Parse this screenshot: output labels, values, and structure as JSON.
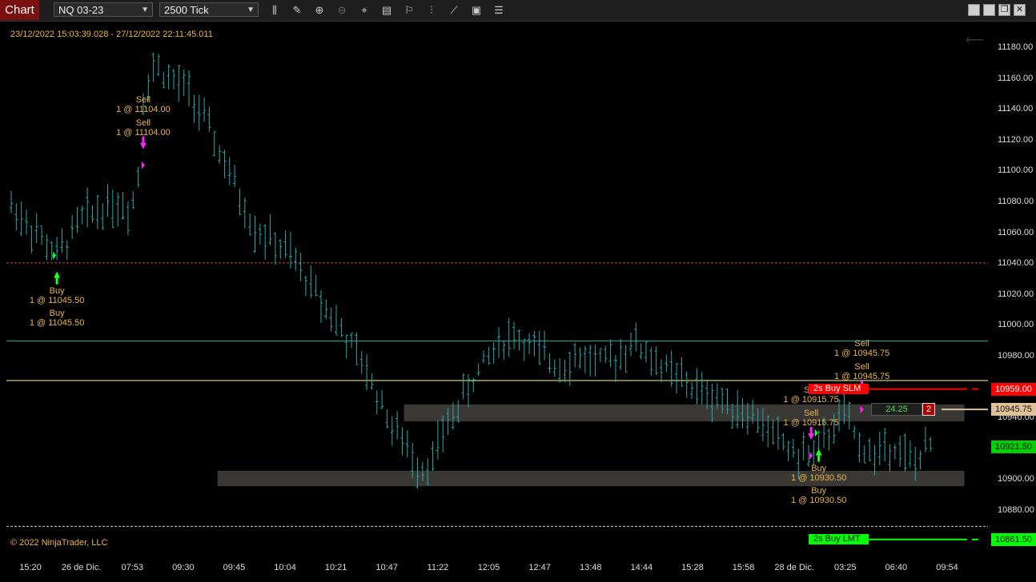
{
  "toolbar": {
    "tab_label": "Chart",
    "instrument": "NQ 03-23",
    "interval": "2500 Tick",
    "tools": [
      "bars-type-icon",
      "draw-tool-icon",
      "zoom-in-icon",
      "zoom-out-icon",
      "crosshair-icon",
      "properties-icon",
      "templates-icon",
      "indicators-icon",
      "strategies-icon",
      "chart-trader-icon",
      "data-box-icon"
    ],
    "window_buttons": [
      "minimize-icon",
      "restore-icon",
      "maximize-icon",
      "close-icon"
    ]
  },
  "chart": {
    "date_range": "23/12/2022 15:03:39.028 - 27/12/2022 22:11:45.011",
    "copyright": "© 2022 NinjaTrader, LLC",
    "colors": {
      "bars": "#2aa8a8",
      "buy_arrow": "#22ff22",
      "sell_arrow": "#ff22ff",
      "annotation": "#e8b34a",
      "zone": "#3a3834"
    }
  },
  "chart_data": {
    "type": "bar",
    "subtype": "ohlc",
    "instrument": "NQ 03-23",
    "interval": "2500 Tick",
    "ylim": [
      10850,
      11195
    ],
    "y_ticks": [
      11180.0,
      11160.0,
      11140.0,
      11120.0,
      11100.0,
      11080.0,
      11060.0,
      11040.0,
      11020.0,
      11000.0,
      10980.0,
      10940.0,
      10920.0,
      10900.0,
      10880.0
    ],
    "x_ticks": [
      "15:20",
      "26 de Dic.",
      "07:53",
      "09:30",
      "09:45",
      "10:04",
      "10:21",
      "10:47",
      "11:22",
      "12:05",
      "12:47",
      "13:48",
      "14:44",
      "15:28",
      "15:58",
      "28 de Dic.",
      "03:25",
      "06:40",
      "09:54"
    ],
    "bar_count": 168,
    "price_path": [
      [
        0,
        11078
      ],
      [
        10,
        11060
      ],
      [
        18,
        11045
      ],
      [
        28,
        11070
      ],
      [
        40,
        11080
      ],
      [
        47,
        11075
      ],
      [
        50,
        11098
      ],
      [
        52,
        11150
      ],
      [
        57,
        11170
      ],
      [
        62,
        11160
      ],
      [
        70,
        11152
      ],
      [
        80,
        11120
      ],
      [
        95,
        11065
      ],
      [
        110,
        11045
      ],
      [
        125,
        11010
      ],
      [
        140,
        10970
      ],
      [
        150,
        10935
      ],
      [
        160,
        10910
      ],
      [
        165,
        10910
      ],
      [
        170,
        10930
      ],
      [
        180,
        10960
      ],
      [
        190,
        10985
      ],
      [
        198,
        10995
      ],
      [
        205,
        10985
      ],
      [
        215,
        10975
      ],
      [
        225,
        10980
      ],
      [
        235,
        10975
      ],
      [
        245,
        10990
      ],
      [
        255,
        10975
      ],
      [
        268,
        10960
      ],
      [
        283,
        10950
      ],
      [
        293,
        10940
      ],
      [
        300,
        10930
      ],
      [
        310,
        10915
      ],
      [
        318,
        10920
      ],
      [
        324,
        10935
      ],
      [
        328,
        10945
      ],
      [
        333,
        10925
      ],
      [
        340,
        10915
      ],
      [
        347,
        10925
      ],
      [
        355,
        10910
      ],
      [
        362,
        10922
      ]
    ],
    "executions": [
      {
        "side": "Buy",
        "label": "Buy",
        "detail": "1 @ 11045.50",
        "price": 11045.5,
        "bar": 18
      },
      {
        "side": "Buy",
        "label": "Buy",
        "detail": "1 @ 11045.50",
        "price": 11045.5,
        "bar": 18
      },
      {
        "side": "Sell",
        "label": "Sell",
        "detail": "1 @ 11104.00",
        "price": 11104.0,
        "bar": 52
      },
      {
        "side": "Sell",
        "label": "Sell",
        "detail": "1 @ 11104.00",
        "price": 11104.0,
        "bar": 52
      },
      {
        "side": "Sell",
        "label": "Sell",
        "detail": "1 @ 10915.75",
        "price": 10915.75,
        "bar": 315
      },
      {
        "side": "Sell",
        "label": "Sell",
        "detail": "1 @ 10915.75",
        "price": 10915.75,
        "bar": 315
      },
      {
        "side": "Buy",
        "label": "Buy",
        "detail": "1 @ 10930.50",
        "price": 10930.5,
        "bar": 318
      },
      {
        "side": "Buy",
        "label": "Buy",
        "detail": "1 @ 10930.50",
        "price": 10930.5,
        "bar": 318
      },
      {
        "side": "Sell",
        "label": "Sell",
        "detail": "1 @ 10945.75",
        "price": 10945.75,
        "bar": 335
      },
      {
        "side": "Sell",
        "label": "Sell",
        "detail": "1 @ 10945.75",
        "price": 10945.75,
        "bar": 335
      }
    ],
    "horizontal_lines": [
      {
        "price": 11040.7,
        "color": "#c0504d",
        "style": "dashed"
      },
      {
        "price": 10990.2,
        "color": "#2ab0a0",
        "style": "solid"
      },
      {
        "price": 10964.5,
        "color": "#ffff88",
        "style": "solid"
      },
      {
        "price": 10870.0,
        "color": "#cccccc",
        "style": "dashed"
      }
    ],
    "zones": [
      {
        "from": 10938,
        "to": 10949,
        "x_start": 0.405,
        "x_end": 0.976
      },
      {
        "from": 10896,
        "to": 10906,
        "x_start": 0.215,
        "x_end": 0.976
      }
    ],
    "orders": [
      {
        "label": "2s  Buy SLM",
        "price": 10959.0,
        "price_label": "10959.00",
        "color": "#ff0000"
      },
      {
        "label": "2s  Buy LMT",
        "price": 10861.5,
        "price_label": "10861.50",
        "color": "#00ff00"
      }
    ],
    "position": {
      "pnl": "24.25",
      "qty": "2",
      "avg_price": 10945.75,
      "avg_label": "10945.75"
    },
    "last_price": {
      "price": 10921.5,
      "label": "10921.50"
    }
  }
}
